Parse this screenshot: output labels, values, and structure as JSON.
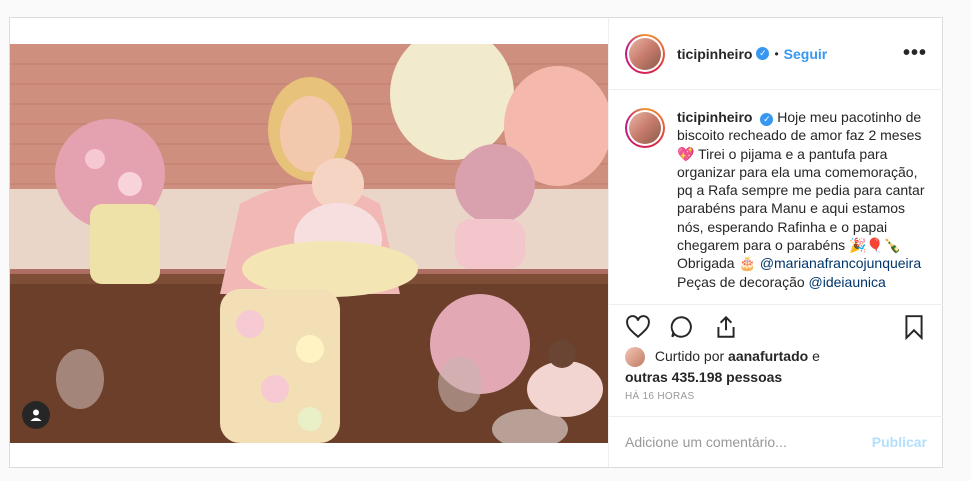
{
  "post": {
    "username": "ticipinheiro",
    "verified_mark": "✓",
    "separator": "•",
    "follow_label": "Seguir",
    "more_label": "•••"
  },
  "caption": {
    "username": "ticipinheiro",
    "text_1": "Hoje meu pacotinho de biscoito recheado de amor faz 2 meses 💖 Tirei o pijama e a pantufa para organizar para ela uma comemoração, pq a Rafa sempre me pedia para cantar parabéns para Manu e aqui estamos nós, esperando Rafinha e o papai chegarem para o parabéns 🎉🎈🍾 Obrigada 🎂",
    "mention_1": "@marianafrancojunqueira",
    "text_2": "Peças de decoração",
    "mention_2": "@ideiaunica"
  },
  "likes": {
    "prefix": "Curtido por",
    "user": "aanafurtado",
    "conj": "e",
    "others": "outras 435.198 pessoas"
  },
  "timestamp": "HÁ 16 HORAS",
  "comment": {
    "placeholder": "Adicione um comentário...",
    "publish_label": "Publicar"
  },
  "colors": {
    "accent": "#3897f0",
    "publish_disabled": "#b2dffc",
    "mention": "#003569"
  }
}
